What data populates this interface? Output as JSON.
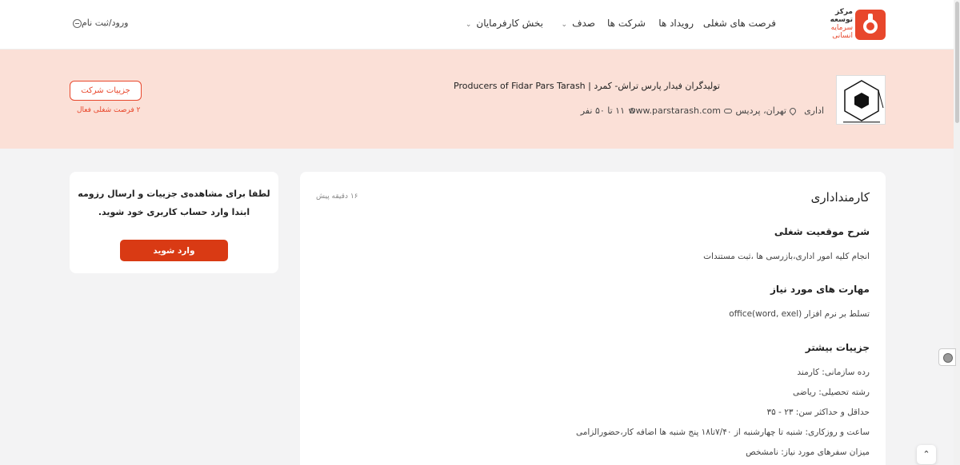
{
  "header": {
    "logo_lines": [
      "مرکز",
      "توسعه",
      "سرمایه",
      "انسانی"
    ],
    "nav": {
      "jobs": "فرصت های شغلی",
      "events": "رویداد ها",
      "companies": "شرکت ها",
      "sadaf": "صدف",
      "employers": "بخش کارفرمایان"
    },
    "login": "ورود/ثبت نام"
  },
  "company": {
    "name": "تولیدگران فیدار پارس تراش- کمرد | Producers of Fidar Pars Tarash",
    "category": "اداری",
    "location": "تهران، پردیس",
    "website": "www.parstarash.com",
    "size": "۱۱ تا ۵۰ نفر",
    "details_button": "جزییات شرکت",
    "active_jobs": "۲ فرصت شغلی فعال"
  },
  "job": {
    "title": "کارمنداداری",
    "time_ago": "۱۶ دقیقه پیش",
    "description_heading": "شرح موقعیت شغلی",
    "description": "انجام کلیه امور اداری،بازرسی ها ،ثبت مستندات",
    "skills_heading": "مهارت های مورد نیاز",
    "skills": "تسلط بر نرم افزار office(word, exel)",
    "more_heading": "جزییات بیشتر",
    "details": [
      "رده سازمانی: کارمند",
      "رشته تحصیلی: ریاضی",
      "حداقل و حداکثر سن: ۲۳ - ۳۵",
      "ساعت و روزکاری: شنبه تا چهارشنبه از ۷/۴۰تا۱۸ پنج شنبه ها اضافه کار،حضورالزامی",
      "میزان سفرهای مورد نیاز: نامشخص"
    ]
  },
  "sidebar": {
    "message": "لطفا برای مشاهده‌ی جزییات و ارسال رزومه ابتدا وارد حساب کاربری خود شوید.",
    "login_button": "وارد شوید"
  },
  "colors": {
    "accent": "#e8472c",
    "banner": "#fbe0d7"
  }
}
